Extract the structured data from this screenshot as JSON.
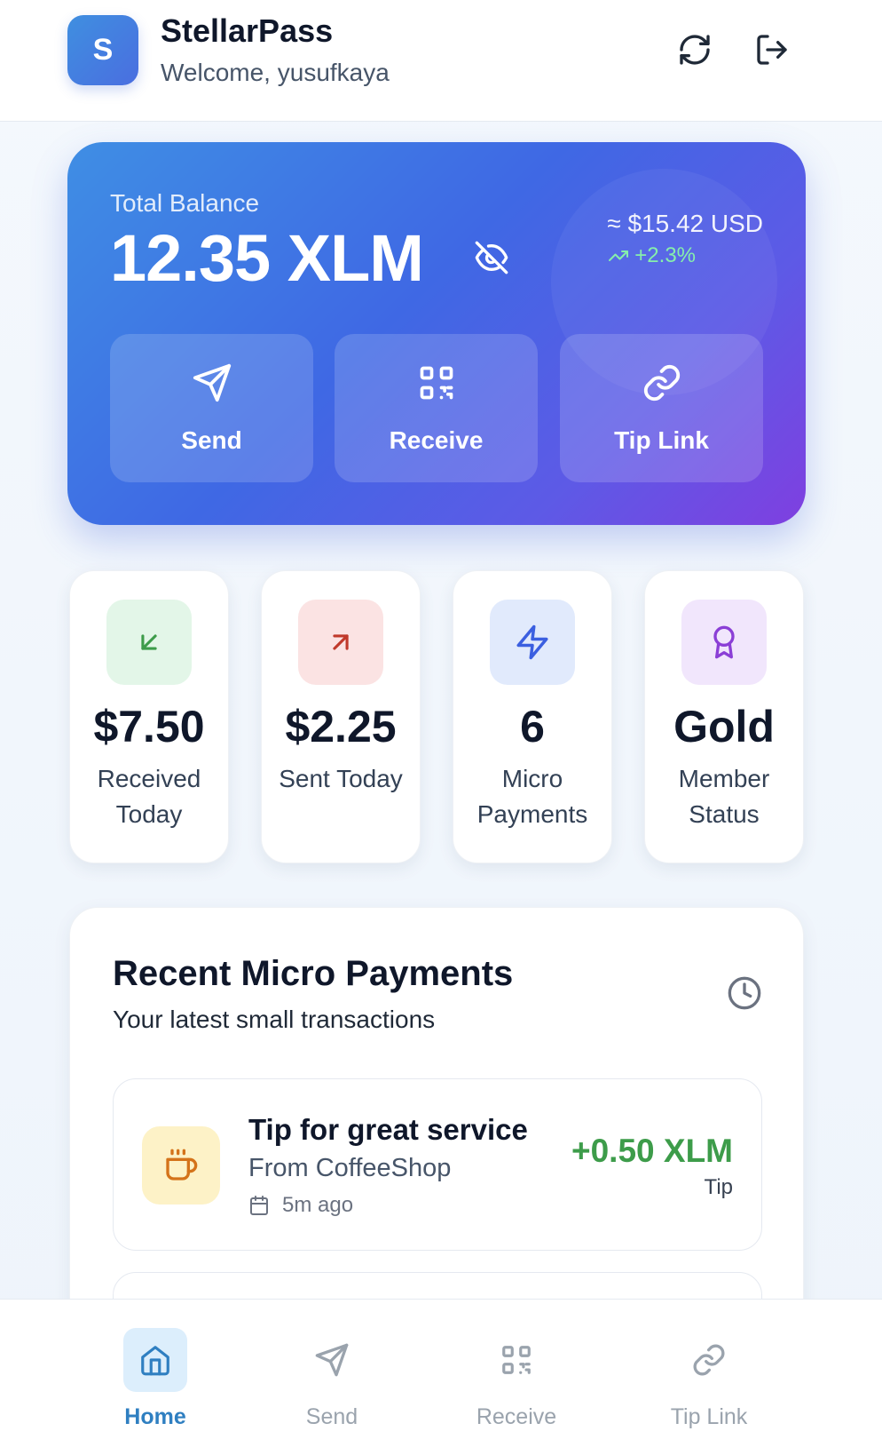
{
  "header": {
    "logo_letter": "S",
    "app_title": "StellarPass",
    "welcome": "Welcome, yusufkaya",
    "icons": [
      "refresh-icon",
      "logout-icon"
    ]
  },
  "balance": {
    "label": "Total Balance",
    "value": "12.35 XLM",
    "usd": "≈ $15.42 USD",
    "change": "+2.3%",
    "actions": [
      {
        "label": "Send",
        "icon": "send-icon"
      },
      {
        "label": "Receive",
        "icon": "qr-code-icon"
      },
      {
        "label": "Tip Link",
        "icon": "link-icon"
      }
    ]
  },
  "stats": [
    {
      "value": "$7.50",
      "caption": "Received Today",
      "icon": "arrow-down-left-icon",
      "color": "#3d9c4a",
      "bg": "#e3f6e8"
    },
    {
      "value": "$2.25",
      "caption": "Sent Today",
      "icon": "arrow-up-right-icon",
      "color": "#c0392b",
      "bg": "#fbe3e3"
    },
    {
      "value": "6",
      "caption": "Micro Payments",
      "icon": "lightning-icon",
      "color": "#3b5fe0",
      "bg": "#e1eafc"
    },
    {
      "value": "Gold",
      "caption": "Member Status",
      "icon": "award-icon",
      "color": "#8b3fd6",
      "bg": "#f1e6fc"
    }
  ],
  "recent": {
    "title": "Recent Micro Payments",
    "subtitle": "Your latest small transactions",
    "transactions": [
      {
        "title": "Tip for great service",
        "from": "From CoffeeShop",
        "time": "5m ago",
        "amount": "+0.50 XLM",
        "type": "Tip",
        "icon": "coffee-icon"
      }
    ]
  },
  "nav": {
    "items": [
      {
        "label": "Home",
        "icon": "home-icon",
        "active": true
      },
      {
        "label": "Send",
        "icon": "send-icon",
        "active": false
      },
      {
        "label": "Receive",
        "icon": "qr-code-icon",
        "active": false
      },
      {
        "label": "Tip Link",
        "icon": "link-icon",
        "active": false
      }
    ]
  }
}
